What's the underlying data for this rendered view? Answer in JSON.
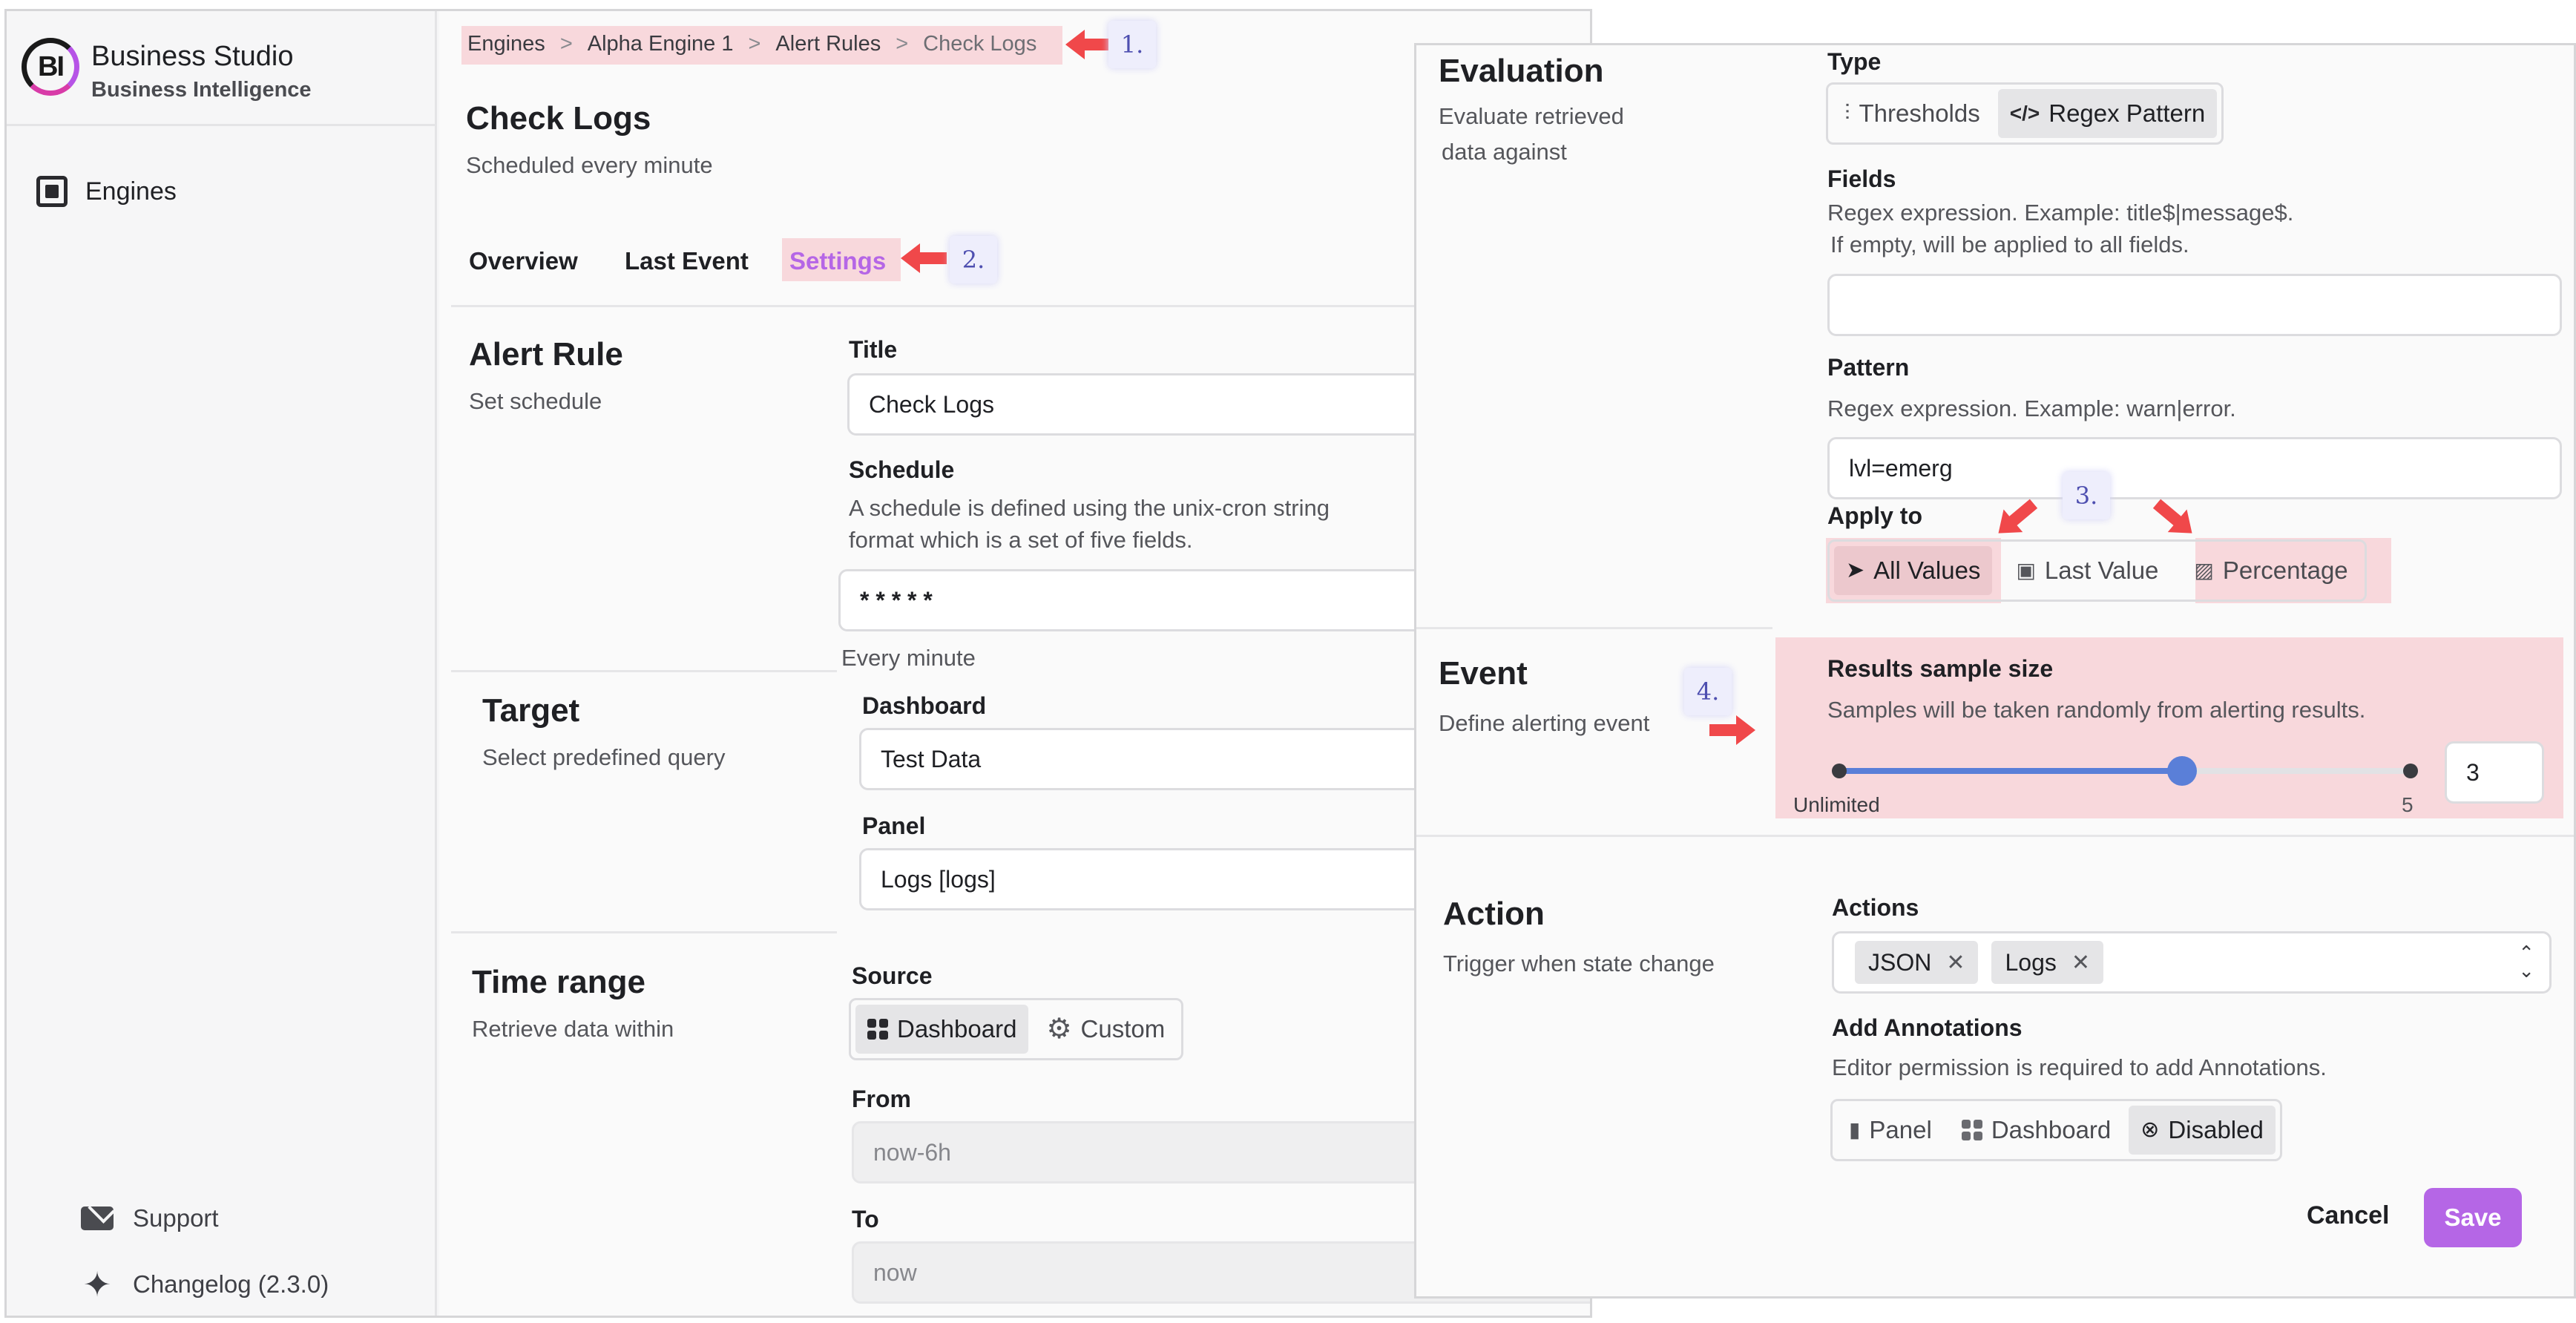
{
  "sidebar": {
    "logo_text": "BI",
    "brand_name": "Business Studio",
    "brand_sub": "Business Intelligence",
    "nav_engines": "Engines",
    "support": "Support",
    "changelog": "Changelog (2.3.0)"
  },
  "breadcrumbs": [
    "Engines",
    "Alpha Engine 1",
    "Alert Rules",
    "Check Logs"
  ],
  "breadcrumb_sep": ">",
  "page": {
    "title": "Check Logs",
    "subtitle": "Scheduled every minute"
  },
  "tabs": [
    "Overview",
    "Last Event",
    "Settings"
  ],
  "alert_rule": {
    "title": "Alert Rule",
    "desc": "Set schedule",
    "title_label": "Title",
    "title_value": "Check Logs",
    "schedule_label": "Schedule",
    "schedule_help_1": "A schedule is defined using the unix-cron string",
    "schedule_help_2": "format which is a set of five fields.",
    "schedule_value": "* * * * *",
    "schedule_hint": "Every minute"
  },
  "target": {
    "title": "Target",
    "desc": "Select predefined query",
    "dashboard_label": "Dashboard",
    "dashboard_value": "Test Data",
    "panel_label": "Panel",
    "panel_value": "Logs [logs]"
  },
  "time_range": {
    "title": "Time range",
    "desc": "Retrieve data within",
    "source_label": "Source",
    "opt_dashboard": "Dashboard",
    "opt_custom": "Custom",
    "from_label": "From",
    "from_value": "now-6h",
    "to_label": "To",
    "to_value": "now"
  },
  "evaluation": {
    "title": "Evaluation",
    "desc_1": "Evaluate retrieved",
    "desc_2": "data against",
    "type_label": "Type",
    "opt_thresholds": "Thresholds",
    "opt_regex": "Regex Pattern",
    "fields_label": "Fields",
    "fields_help_1": "Regex expression. Example: title$|message$.",
    "fields_help_2": "If empty, will be applied to all fields.",
    "fields_value": "",
    "pattern_label": "Pattern",
    "pattern_help": "Regex expression. Example: warn|error.",
    "pattern_value": "lvl=emerg",
    "apply_label": "Apply to",
    "opt_all": "All Values",
    "opt_last": "Last Value",
    "opt_pct": "Percentage"
  },
  "event": {
    "title": "Event",
    "desc": "Define alerting event",
    "sample_label": "Results sample size",
    "sample_help": "Samples will be taken randomly from alerting results.",
    "min_label": "Unlimited",
    "max_label": "5",
    "value": "3",
    "slider_value": 3,
    "slider_max": 5
  },
  "action": {
    "title": "Action",
    "desc": "Trigger when state change",
    "actions_label": "Actions",
    "tags": [
      "JSON",
      "Logs"
    ],
    "tag_remove": "✕",
    "annotations_label": "Add Annotations",
    "annotations_help": "Editor permission is required to add Annotations.",
    "opt_panel": "Panel",
    "opt_dashboard": "Dashboard",
    "opt_disabled": "Disabled",
    "cancel": "Cancel",
    "save": "Save"
  },
  "annotations": [
    "1.",
    "2.",
    "3.",
    "4."
  ],
  "colors": {
    "accent": "#b566e6",
    "highlight": "#f8d8dc",
    "arrow": "#f0484a",
    "slider": "#5a7fd8"
  }
}
